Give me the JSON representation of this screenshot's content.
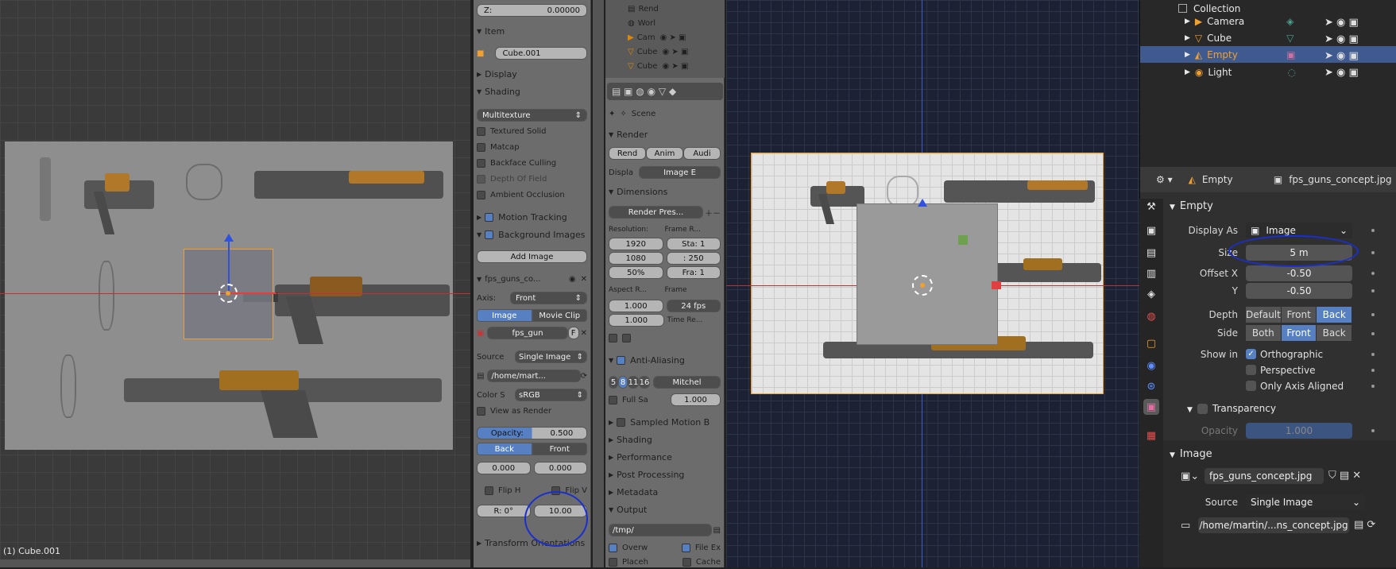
{
  "left_panel": {
    "z_label": "Z:",
    "z_value": "0.00000",
    "item_header": "Item",
    "item_name": "Cube.001",
    "display_header": "Display",
    "shading_header": "Shading",
    "shading_mode": "Multitexture",
    "textured_solid": "Textured Solid",
    "matcap": "Matcap",
    "backface_culling": "Backface Culling",
    "depth_of_field": "Depth Of Field",
    "ambient_occlusion": "Ambient Occlusion",
    "motion_tracking": "Motion Tracking",
    "background_images": "Background Images",
    "add_image": "Add Image",
    "bg_image_name": "fps_guns_co...",
    "axis_label": "Axis:",
    "axis_value": "Front",
    "image_tab": "Image",
    "movie_clip_tab": "Movie Clip",
    "img_datablock": "fps_gun",
    "img_f": "F",
    "source_label": "Source",
    "source_value": "Single Image",
    "path": "/home/mart...",
    "color_space_label": "Color S",
    "color_space_value": "sRGB",
    "view_as_render": "View as Render",
    "opacity_label": "Opacity:",
    "opacity_value": "0.500",
    "back": "Back",
    "front": "Front",
    "off_x": "0.000",
    "off_y": "0.000",
    "flip_h": "Flip H",
    "flip_v": "Flip V",
    "rotation": "R: 0°",
    "size_value": "10.00",
    "transform_orientations": "Transform Orientations"
  },
  "mid_panel": {
    "outliner_items": [
      "Rend",
      "Worl",
      "Cam",
      "Cube",
      "Cube"
    ],
    "scene_label": "Scene",
    "render_header": "Render",
    "render_btn": "Rend",
    "anim_btn": "Anim",
    "audio_btn": "Audi",
    "display_label": "Displa",
    "display_value": "Image E",
    "dimensions_header": "Dimensions",
    "render_presets": "Render Pres...",
    "resolution_label": "Resolution:",
    "frame_range_label": "Frame R...",
    "res_x": "1920",
    "res_y": "1080",
    "res_pct": "50%",
    "start": "Sta: 1",
    "end": ": 250",
    "frame_step": "Fra: 1",
    "aspect_label": "Aspect R...",
    "frame_rate_label": "Frame",
    "aspect_x": "1.000",
    "aspect_y": "1.000",
    "fps": "24 fps",
    "time_remap": "Time Re...",
    "anti_aliasing": "Anti-Aliasing",
    "aa_5": "5",
    "aa_8": "8",
    "aa_11": "11",
    "aa_16": "16",
    "aa_filter": "Mitchel",
    "full_sample": "Full Sa",
    "filter_size": "1.000",
    "sampled_motion_blur": "Sampled Motion B",
    "shading": "Shading",
    "performance": "Performance",
    "post_processing": "Post Processing",
    "metadata": "Metadata",
    "output": "Output",
    "output_path": "/tmp/",
    "overwrite": "Overw",
    "file_ext": "File Ex",
    "placeholders": "Placeh",
    "cache": "Cache"
  },
  "left_status": "(1) Cube.001",
  "outliner": {
    "collection": "Collection",
    "items": [
      "Camera",
      "Cube",
      "Empty",
      "Light"
    ]
  },
  "properties": {
    "object_name": "Empty",
    "data_name": "fps_guns_concept.jpg",
    "empty_header": "Empty",
    "display_as_label": "Display As",
    "display_as_value": "Image",
    "size_label": "Size",
    "size_value": "5 m",
    "offset_x_label": "Offset X",
    "offset_x_value": "-0.50",
    "offset_y_label": "Y",
    "offset_y_value": "-0.50",
    "depth_label": "Depth",
    "depth_options": [
      "Default",
      "Front",
      "Back"
    ],
    "side_label": "Side",
    "side_options": [
      "Both",
      "Front",
      "Back"
    ],
    "show_in_label": "Show in",
    "orthographic": "Orthographic",
    "perspective": "Perspective",
    "only_axis_aligned": "Only Axis Aligned",
    "transparency": "Transparency",
    "opacity_label": "Opacity",
    "opacity_value": "1.000",
    "image_header": "Image",
    "image_name": "fps_guns_concept.jpg",
    "source_label": "Source",
    "source_value": "Single Image",
    "filepath": "/home/martin/...ns_concept.jpg"
  },
  "colors": {
    "accent": "#5680c2",
    "selection_orange": "#f0a030",
    "annotation_blue": "#1a2fd0"
  }
}
